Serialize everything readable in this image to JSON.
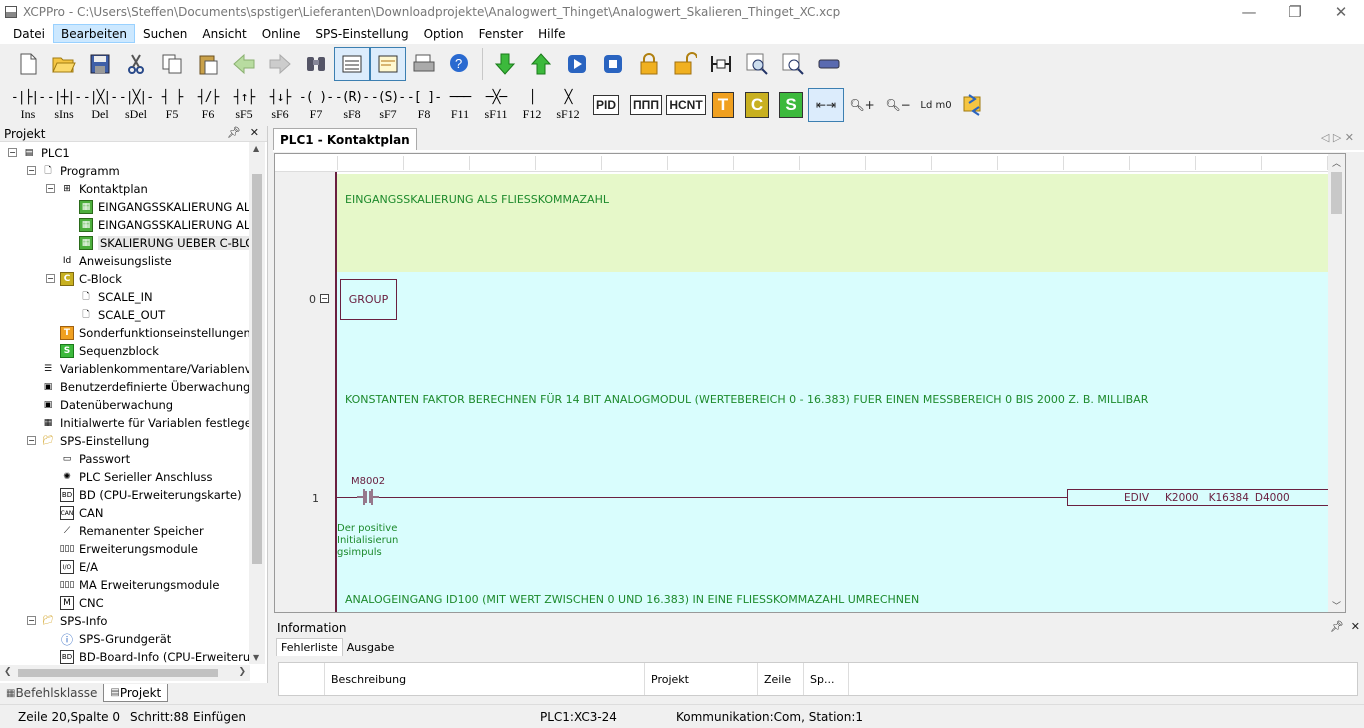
{
  "window": {
    "title": "XCPPro - C:\\Users\\Steffen\\Documents\\spstiger\\Lieferanten\\Downloadprojekte\\Analogwert_Thinget\\Analogwert_Skalieren_Thinget_XC.xcp"
  },
  "menu": [
    "Datei",
    "Bearbeiten",
    "Suchen",
    "Ansicht",
    "Online",
    "SPS-Einstellung",
    "Option",
    "Fenster",
    "Hilfe"
  ],
  "ladder_toolbar": [
    {
      "sym": "-|├|-",
      "label": "Ins"
    },
    {
      "sym": "-|┼|-",
      "label": "sIns"
    },
    {
      "sym": "-|╳|-",
      "label": "Del"
    },
    {
      "sym": "-|╳|-",
      "label": "sDel"
    },
    {
      "sym": "┤ ├",
      "label": "F5"
    },
    {
      "sym": "┤/├",
      "label": "F6"
    },
    {
      "sym": "┤↑├",
      "label": "sF5"
    },
    {
      "sym": "┤↓├",
      "label": "sF6"
    },
    {
      "sym": "-( )-",
      "label": "F7"
    },
    {
      "sym": "-(R)-",
      "label": "sF8"
    },
    {
      "sym": "-(S)-",
      "label": "sF7"
    },
    {
      "sym": "-[ ]-",
      "label": "F8"
    },
    {
      "sym": "───",
      "label": "F11"
    },
    {
      "sym": "─╳─",
      "label": "sF11"
    },
    {
      "sym": "│",
      "label": "F12"
    },
    {
      "sym": "╳",
      "label": "sF12"
    }
  ],
  "ladder_boxes": [
    "PID",
    "ΠΠΠ",
    "HCNT",
    "T",
    "C",
    "S"
  ],
  "misc_label": "Ld m0",
  "project_panel": {
    "title": "Projekt",
    "tree": [
      {
        "label": "PLC1",
        "level": 0,
        "icon": "plc-icon",
        "exp": "-"
      },
      {
        "label": "Programm",
        "level": 1,
        "icon": "document-icon",
        "exp": "-"
      },
      {
        "label": "Kontaktplan",
        "level": 2,
        "icon": "ladder-icon",
        "exp": "-"
      },
      {
        "label": "EINGANGSSKALIERUNG ALS FLIESSKOMMAZAHL",
        "level": 3,
        "icon": "block-icon"
      },
      {
        "label": "EINGANGSSKALIERUNG ALS INTEGER",
        "level": 3,
        "icon": "block-icon"
      },
      {
        "label": "SKALIERUNG UEBER C-BLOCK",
        "level": 3,
        "icon": "block-icon",
        "sel": true
      },
      {
        "label": "Anweisungsliste",
        "level": 2,
        "icon": "instruction-list-icon"
      },
      {
        "label": "C-Block",
        "level": 2,
        "icon": "c-block-icon",
        "exp": "-"
      },
      {
        "label": "SCALE_IN",
        "level": 3,
        "icon": "document-icon"
      },
      {
        "label": "SCALE_OUT",
        "level": 3,
        "icon": "document-icon"
      },
      {
        "label": "Sonderfunktionseinstellungen",
        "level": 2,
        "icon": "t-icon"
      },
      {
        "label": "Sequenzblock",
        "level": 2,
        "icon": "s-icon"
      },
      {
        "label": "Variablenkommentare/Variablenverwendung",
        "level": 1,
        "icon": "list-icon"
      },
      {
        "label": "Benutzerdefinierte Überwachung",
        "level": 1,
        "icon": "monitor-icon"
      },
      {
        "label": "Datenüberwachung",
        "level": 1,
        "icon": "monitor-icon"
      },
      {
        "label": "Initialwerte für Variablen festlegen",
        "level": 1,
        "icon": "table-icon"
      },
      {
        "label": "SPS-Einstellung",
        "level": 1,
        "icon": "folder-icon",
        "exp": "-"
      },
      {
        "label": "Passwort",
        "level": 2,
        "icon": "password-icon"
      },
      {
        "label": "PLC Serieller Anschluss",
        "level": 2,
        "icon": "serial-icon"
      },
      {
        "label": "BD (CPU-Erweiterungskarte)",
        "level": 2,
        "icon": "bd-icon"
      },
      {
        "label": "CAN",
        "level": 2,
        "icon": "can-icon"
      },
      {
        "label": "Remanenter Speicher",
        "level": 2,
        "icon": "memory-icon"
      },
      {
        "label": "Erweiterungsmodule",
        "level": 2,
        "icon": "module-icon"
      },
      {
        "label": "E/A",
        "level": 2,
        "icon": "io-icon"
      },
      {
        "label": "MA Erweiterungsmodule",
        "level": 2,
        "icon": "module-icon"
      },
      {
        "label": "CNC",
        "level": 2,
        "icon": "cnc-icon"
      },
      {
        "label": "SPS-Info",
        "level": 1,
        "icon": "folder-icon",
        "exp": "-"
      },
      {
        "label": "SPS-Grundgerät",
        "level": 2,
        "icon": "info-icon"
      },
      {
        "label": "BD-Board-Info (CPU-Erweiterungskarte)",
        "level": 2,
        "icon": "bd-icon"
      }
    ]
  },
  "bottom_tabs": [
    "Befehlsklasse",
    "Projekt"
  ],
  "editor": {
    "tab": "PLC1 - Kontaktplan",
    "comment1": "EINGANGSSKALIERUNG ALS FLIESSKOMMAZAHL",
    "rung0": "0",
    "group": "GROUP",
    "comment2": "KONSTANTEN FAKTOR BERECHNEN FÜR 14 BIT ANALOGMODUL (WERTEBEREICH 0 - 16.383) FUER EINEN MESSBEREICH 0 BIS 2000 Z. B. MILLIBAR",
    "rung1": "1",
    "contact": "M8002",
    "contact_comment": [
      "Der positive",
      "Initialisierun",
      "gsimpuls"
    ],
    "instruction": {
      "op": "EDIV",
      "a": "K2000",
      "b": "K16384",
      "c": "D4000"
    },
    "comment3": "ANALOGEINGANG ID100 (MIT WERT ZWISCHEN 0 UND 16.383) IN EINE FLIESSKOMMAZAHL UMRECHNEN"
  },
  "info": {
    "title": "Information",
    "tabs": [
      "Fehlerliste",
      "Ausgabe"
    ],
    "columns": [
      "Beschreibung",
      "Projekt",
      "Zeile",
      "Sp..."
    ]
  },
  "status": {
    "pos": "Zeile 20,Spalte 0",
    "step": "Schritt:88",
    "mode": "Einfügen",
    "plc": "PLC1:XC3-24",
    "comm": "Kommunikation:Com, Station:1"
  },
  "colors": {
    "comment_bg": "#e6f8c9",
    "rung_bg": "#d9fdfd",
    "rail": "#6a2040",
    "comment_text": "#1d8a2c",
    "instr": "#6a2040"
  }
}
